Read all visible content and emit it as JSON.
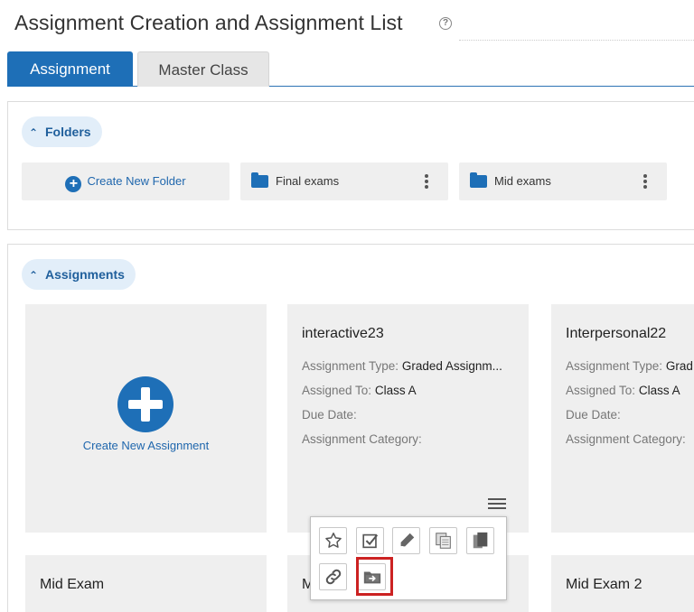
{
  "header": {
    "title": "Assignment Creation and Assignment List",
    "help_icon": "?"
  },
  "tabs": [
    {
      "label": "Assignment",
      "active": true
    },
    {
      "label": "Master Class",
      "active": false
    }
  ],
  "folders": {
    "section_label": "Folders",
    "create_label": "Create New Folder",
    "items": [
      {
        "name": "Final exams"
      },
      {
        "name": "Mid exams"
      }
    ]
  },
  "assignments": {
    "section_label": "Assignments",
    "create_label": "Create New Assignment",
    "field_labels": {
      "type": "Assignment Type:",
      "assigned_to": "Assigned To:",
      "due_date": "Due Date:",
      "category": "Assignment Category:"
    },
    "cards": [
      {
        "title": "interactive23",
        "type": "Graded Assignm...",
        "assigned_to": "Class A",
        "due_date": "",
        "category": ""
      },
      {
        "title": "Interpersonal22",
        "type": "Grad",
        "assigned_to": "Class A",
        "due_date": "",
        "category": ""
      }
    ],
    "bottom_cards": [
      {
        "title": "Mid Exam"
      },
      {
        "title": "M"
      },
      {
        "title": "Mid Exam 2"
      }
    ]
  },
  "popup_menu": {
    "icons": [
      "star-icon",
      "checkbox-icon",
      "pencil-icon",
      "copy-icon",
      "documents-icon",
      "link-icon",
      "move-to-folder-icon"
    ],
    "highlighted": "move-to-folder-icon"
  },
  "colors": {
    "accent": "#1e6fb7",
    "highlight": "#cc2222",
    "card_bg": "#efefef"
  }
}
